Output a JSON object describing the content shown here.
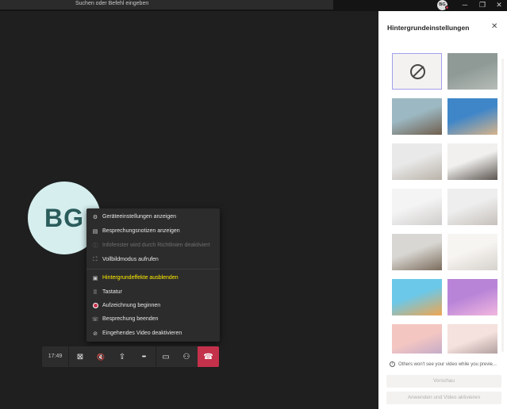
{
  "titlebar": {
    "search_placeholder": "Suchen oder Befehl eingeben",
    "user_initials": "BG",
    "minimize": "─",
    "maximize": "❐",
    "close": "✕"
  },
  "participant": {
    "initials": "BG"
  },
  "menu": {
    "items": [
      {
        "label": "Geräteeinstellungen anzeigen",
        "icon": "gear-icon",
        "glyph": "⚙"
      },
      {
        "label": "Besprechungsnotizen anzeigen",
        "icon": "notes-icon",
        "glyph": "▤"
      },
      {
        "label": "Infofenster wird durch Richtlinien deaktiviert",
        "icon": "info-icon",
        "glyph": "ⓘ"
      },
      {
        "label": "Vollbildmodus aufrufen",
        "icon": "fullscreen-icon",
        "glyph": "⛶"
      },
      {
        "label": "Hintergrundeffekte ausblenden",
        "icon": "background-icon",
        "glyph": "▣"
      },
      {
        "label": "Tastatur",
        "icon": "keyboard-icon",
        "glyph": "⠿"
      },
      {
        "label": "Aufzeichnung beginnen",
        "icon": "record-icon",
        "glyph": ""
      },
      {
        "label": "Besprechung beenden",
        "icon": "end-meeting-icon",
        "glyph": "☏"
      },
      {
        "label": "Eingehendes Video deaktivieren",
        "icon": "video-off-icon",
        "glyph": "⊘"
      }
    ]
  },
  "callbar": {
    "time": "17:49",
    "camera_icon": "camera-off-icon",
    "mic_icon": "mic-off-icon",
    "share_icon": "share-screen-icon",
    "more_icon": "more-icon",
    "chat_icon": "chat-icon",
    "people_icon": "people-icon",
    "hangup_icon": "hangup-icon",
    "glyphs": {
      "camera": "⊠",
      "mic": "🔇",
      "share": "⇪",
      "more": "•••",
      "chat": "▭",
      "people": "⚇",
      "hangup": "☎"
    }
  },
  "panel": {
    "title": "Hintergrundeinstellungen",
    "close": "✕",
    "info_text": "Others won't see your video while you previe...",
    "preview_label": "Vorschau",
    "apply_label": "Anwenden und Video aktivieren",
    "backgrounds": [
      {
        "name": "none",
        "colors": [
          "#f3f2f1",
          "#f3f2f1"
        ]
      },
      {
        "name": "blur",
        "colors": [
          "#8f9a96",
          "#b7bdb8"
        ]
      },
      {
        "name": "office-glass",
        "colors": [
          "#9cb8c2",
          "#6f5e4d"
        ]
      },
      {
        "name": "city-sky",
        "colors": [
          "#3f86c9",
          "#d8b48a"
        ]
      },
      {
        "name": "white-room",
        "colors": [
          "#e9e9e9",
          "#b9b2a8"
        ]
      },
      {
        "name": "loft-window",
        "colors": [
          "#f1f0ee",
          "#5b5550"
        ]
      },
      {
        "name": "minimal-room",
        "colors": [
          "#f4f4f4",
          "#cfcdcb"
        ]
      },
      {
        "name": "gallery",
        "colors": [
          "#eeeeee",
          "#c6c0bb"
        ]
      },
      {
        "name": "office-desks",
        "colors": [
          "#d9d7d3",
          "#7b6c5c"
        ]
      },
      {
        "name": "bright-corner",
        "colors": [
          "#f7f5f2",
          "#d6d2cc"
        ]
      },
      {
        "name": "balloons-purple",
        "colors": [
          "#6cc8e8",
          "#f0a64f"
        ]
      },
      {
        "name": "balloons-pink",
        "colors": [
          "#b884d8",
          "#f2b7df"
        ]
      },
      {
        "name": "pastel-arch",
        "colors": [
          "#f3c6c2",
          "#b7a3c9"
        ]
      },
      {
        "name": "pink-curve",
        "colors": [
          "#f5e1dd",
          "#9c8c8c"
        ]
      }
    ]
  }
}
